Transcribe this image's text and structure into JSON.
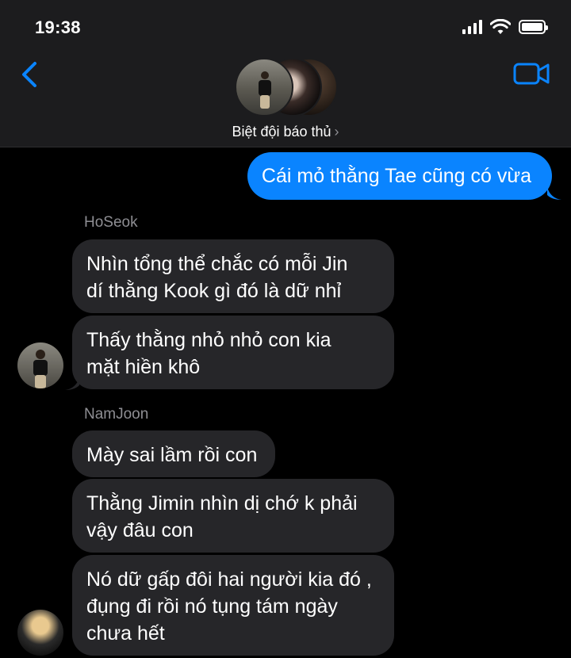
{
  "status_bar": {
    "time": "19:38"
  },
  "header": {
    "group_name": "Biệt đội báo thủ",
    "chevron": "›",
    "icons": {
      "back": "chevron-left-icon",
      "video": "video-camera-icon"
    },
    "accent_color": "#0a84ff"
  },
  "messages": [
    {
      "type": "outgoing",
      "text": "Cái mỏ thằng Tae cũng có vừa"
    },
    {
      "type": "sender",
      "name": "HoSeok"
    },
    {
      "type": "incoming",
      "lines": [
        "Nhìn tổng thể chắc có mỗi Jin",
        "dí thằng Kook gì đó là dữ nhỉ"
      ]
    },
    {
      "type": "incoming",
      "lines": [
        "Thấy thằng nhỏ nhỏ con kia",
        "mặt hiền khô"
      ]
    },
    {
      "type": "sender",
      "name": "NamJoon"
    },
    {
      "type": "incoming",
      "lines": [
        "Mày sai lầm rồi con"
      ]
    },
    {
      "type": "incoming",
      "lines": [
        "Thằng Jimin nhìn dị chớ k phải",
        "vậy đâu con"
      ]
    },
    {
      "type": "incoming",
      "lines": [
        "Nó dữ gấp đôi hai người kia đó ,",
        "đụng đi rồi nó tụng tám ngày",
        "chưa hết"
      ]
    }
  ]
}
